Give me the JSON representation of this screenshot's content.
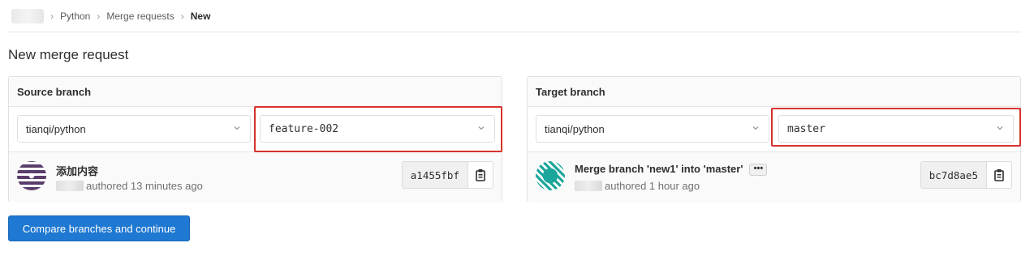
{
  "breadcrumb": {
    "items": [
      "Python",
      "Merge requests",
      "New"
    ],
    "separator": "›"
  },
  "page": {
    "title": "New merge request"
  },
  "source": {
    "header": "Source branch",
    "project": "tianqi/python",
    "branch": "feature-002",
    "commit": {
      "title": "添加内容",
      "meta": "authored 13 minutes ago",
      "sha": "a1455fbf"
    }
  },
  "target": {
    "header": "Target branch",
    "project": "tianqi/python",
    "branch": "master",
    "commit": {
      "title": "Merge branch 'new1' into 'master'",
      "ellipsis": "•••",
      "meta": "authored 1 hour ago",
      "sha": "bc7d8ae5"
    }
  },
  "actions": {
    "compare_label": "Compare branches and continue"
  },
  "colors": {
    "primary": "#1f78d1",
    "highlight": "#d6322d",
    "panel_header_bg": "#fafafa",
    "border": "#e0e0e0"
  },
  "icons": {
    "chevron": "chevron-down-icon",
    "copy": "clipboard-icon",
    "breadcrumb_sep": "angle-right-icon"
  }
}
